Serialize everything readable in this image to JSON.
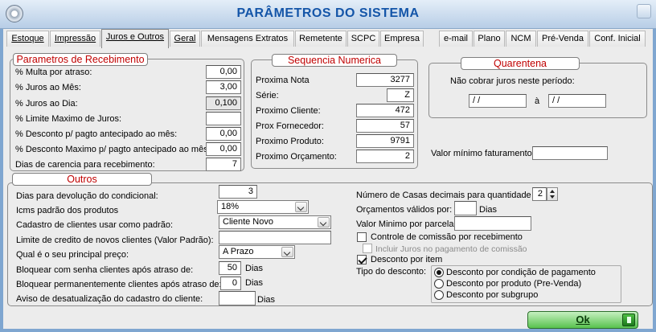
{
  "window": {
    "title": "PARÂMETROS DO SISTEMA"
  },
  "tabs": [
    {
      "label": "Estoque"
    },
    {
      "label": "Impressão"
    },
    {
      "label": "Juros e Outros"
    },
    {
      "label": "Geral"
    },
    {
      "label": "Mensagens Extratos"
    },
    {
      "label": "Remetente"
    },
    {
      "label": "SCPC"
    },
    {
      "label": "Empresa"
    },
    {
      "label": "e-mail"
    },
    {
      "label": "Plano"
    },
    {
      "label": "NCM"
    },
    {
      "label": "Pré-Venda"
    },
    {
      "label": "Conf. Inicial"
    }
  ],
  "recebimento": {
    "title": "Parametros de Recebimento",
    "multa_label": "% Multa por atraso:",
    "multa_value": "0,00",
    "juros_mes_label": "% Juros ao Mês:",
    "juros_mes_value": "3,00",
    "juros_dia_label": "% Juros ao Dia:",
    "juros_dia_value": "0,100",
    "limite_juros_label": "% Limite Maximo de Juros:",
    "limite_juros_value": "",
    "desconto_label": "% Desconto p/ pagto antecipado ao mês:",
    "desconto_value": "0,00",
    "desconto_max_label": "% Desconto Maximo p/ pagto antecipado ao mês:",
    "desconto_max_value": "0,00",
    "carencia_label": "Dias de carencia para recebimento:",
    "carencia_value": "7"
  },
  "sequencia": {
    "title": "Sequencia Numerica",
    "nota_label": "Proxima Nota",
    "nota_value": "3277",
    "serie_label": "Série:",
    "serie_value": "Z",
    "cliente_label": "Proximo Cliente:",
    "cliente_value": "472",
    "fornecedor_label": "Prox Fornecedor:",
    "fornecedor_value": "57",
    "produto_label": "Proximo Produto:",
    "produto_value": "9791",
    "orcamento_label": "Proximo Orçamento:",
    "orcamento_value": "2"
  },
  "quarentena": {
    "title": "Quarentena",
    "text": "Não cobrar juros neste período:",
    "date_from": " / /",
    "separator": "à",
    "date_to": " / /"
  },
  "faturamento": {
    "label": "Valor mínimo faturamento:",
    "value": ""
  },
  "outros": {
    "title": "Outros",
    "devolucao_label": "Dias para devolução do condicional:",
    "devolucao_value": "3",
    "icms_label": "Icms padrão dos produtos",
    "icms_value": "18%",
    "cadastro_label": "Cadastro de clientes usar como padrão:",
    "cadastro_value": "Cliente Novo",
    "limite_credito_label": "Limite de credito de novos clientes (Valor Padrão):",
    "limite_credito_value": "",
    "preco_label": "Qual é o seu principal preço:",
    "preco_value": "A Prazo",
    "bloquear_senha_label": "Bloquear com senha clientes após atraso de:",
    "bloquear_senha_value": "50",
    "bloquear_senha_unit": "Dias",
    "bloquear_perm_label": "Bloquear permanentemente clientes após atraso de:",
    "bloquear_perm_value": "0",
    "bloquear_perm_unit": "Dias",
    "aviso_label": "Aviso de desatualização do cadastro do cliente:",
    "aviso_value": "",
    "aviso_unit": "Dias",
    "casas_label": "Número de Casas decimais para quantidade",
    "casas_value": "2",
    "orcamentos_label": "Orçamentos válidos por:",
    "orcamentos_value": "",
    "orcamentos_unit": "Dias",
    "valor_minimo_label": "Valor Minimo por parcela:",
    "valor_minimo_value": "",
    "controle_label": "Controle de comissão por recebimento",
    "controle_checked": false,
    "incluir_label": "Incluir Juros no pagamento de comissão",
    "incluir_checked": false,
    "desconto_item_label": "Desconto por item",
    "desconto_item_checked": true,
    "tipo_label": "Tipo do desconto:",
    "tipo_options": [
      {
        "label": "Desconto por condição de pagamento",
        "selected": true
      },
      {
        "label": "Desconto por produto (Pre-Venda)",
        "selected": false
      },
      {
        "label": "Desconto por subgrupo",
        "selected": false
      }
    ]
  },
  "ok_button": {
    "label": "Ok"
  }
}
